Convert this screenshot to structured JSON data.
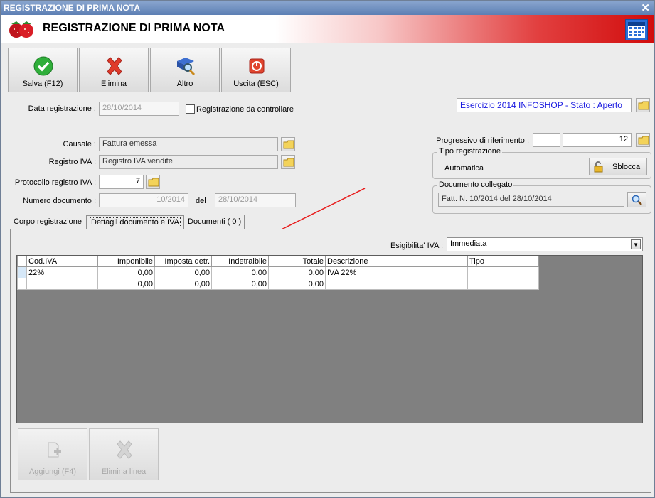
{
  "window": {
    "title": "REGISTRAZIONE DI PRIMA NOTA",
    "close_glyph": "✕"
  },
  "header": {
    "title": "REGISTRAZIONE DI PRIMA NOTA",
    "logo_icon": "strawberry-logo-icon",
    "calendar_icon": "calendar-icon"
  },
  "toolbar": {
    "save_label": "Salva (F12)",
    "delete_label": "Elimina",
    "other_label": "Altro",
    "exit_label": "Uscita (ESC)"
  },
  "form": {
    "data_registrazione_label": "Data registrazione :",
    "data_registrazione_value": "28/10/2014",
    "da_controllare_label": "Registrazione da controllare",
    "esercizio_text": "Esercizio 2014 INFOSHOP - Stato : Aperto",
    "causale_label": "Causale :",
    "causale_value": "Fattura emessa",
    "registro_iva_label": "Registro IVA :",
    "registro_iva_value": "Registro IVA vendite",
    "protocollo_label": "Protocollo registro IVA :",
    "protocollo_value": "7",
    "numero_documento_label": "Numero documento :",
    "numero_documento_value": "10/2014",
    "del_label": "del",
    "del_value": "28/10/2014",
    "progressivo_label": "Progressivo di riferimento :",
    "progressivo_prefix": "",
    "progressivo_value": "12",
    "tipo_registrazione_caption": "Tipo registrazione",
    "tipo_registrazione_value": "Automatica",
    "sblocca_label": "Sblocca",
    "documento_collegato_caption": "Documento collegato",
    "documento_collegato_value": "Fatt. N. 10/2014 del 28/10/2014"
  },
  "tabs": [
    {
      "label": "Corpo registrazione"
    },
    {
      "label": "Dettagli documento e IVA"
    },
    {
      "label": "Documenti ( 0 )"
    }
  ],
  "iva": {
    "esigibilita_label": "Esigibilita' IVA :",
    "esigibilita_value": "Immediata",
    "columns": [
      "Cod.IVA",
      "Imponibile",
      "Imposta detr.",
      "Indetraibile",
      "Totale",
      "Descrizione",
      "Tipo"
    ],
    "rows": [
      [
        "22%",
        "0,00",
        "0,00",
        "0,00",
        "0,00",
        "IVA 22%",
        ""
      ],
      [
        "",
        "0,00",
        "0,00",
        "0,00",
        "0,00",
        "",
        ""
      ]
    ]
  },
  "bottom": {
    "add_label": "Aggiungi (F4)",
    "remove_label": "Elimina linea"
  },
  "colors": {
    "accent_red": "#d10c0c",
    "link_blue": "#1a1ae0",
    "grid_gray": "#808080"
  }
}
